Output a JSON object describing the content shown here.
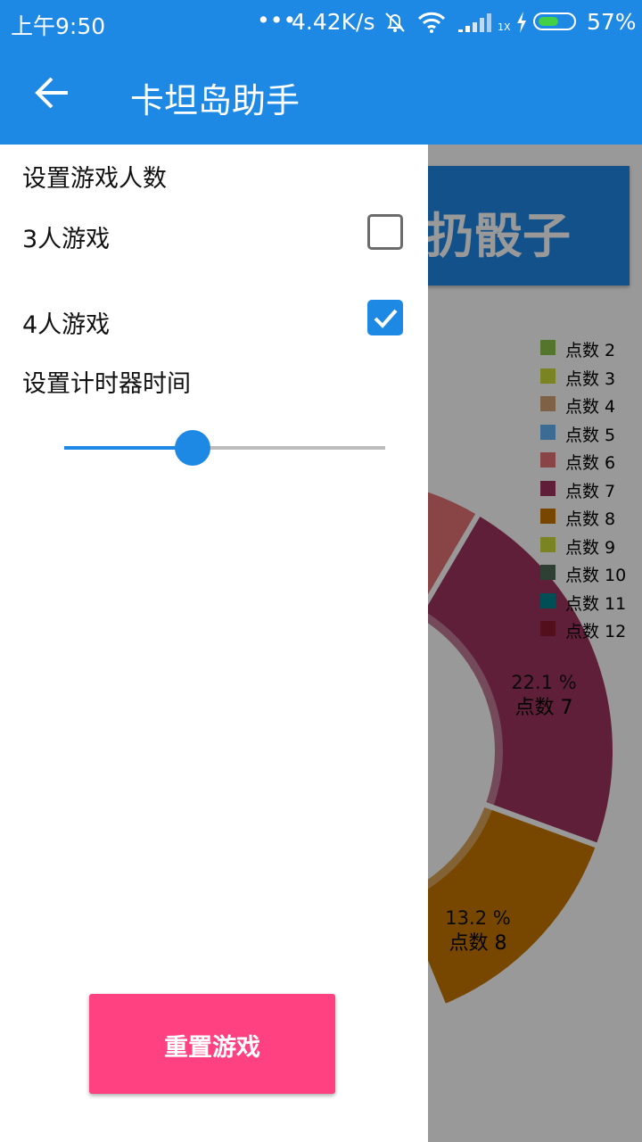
{
  "status_bar": {
    "time": "上午9:50",
    "dots": "•••",
    "speed": "4.42K/s",
    "network_type": "1X",
    "battery_percent": "57%",
    "battery_level": 0.57,
    "icons": [
      "bell-off-icon",
      "wifi-icon",
      "signal-icon",
      "charging-icon",
      "battery-icon"
    ]
  },
  "app_bar": {
    "title": "卡坦岛助手",
    "back_icon": "arrow-back-icon"
  },
  "background": {
    "roll_button_label": "扔骰子",
    "roll_button_visible_text": "扔骰子"
  },
  "chart_data": {
    "type": "pie",
    "style": "donut",
    "legend_position": "top-right",
    "series_names": [
      "点数 2",
      "点数 3",
      "点数 4",
      "点数 5",
      "点数 6",
      "点数 7",
      "点数 8",
      "点数 9",
      "点数 10",
      "点数 11",
      "点数 12"
    ],
    "colors": [
      "#8bc34a",
      "#cddc39",
      "#d4a373",
      "#64b5f6",
      "#e57373",
      "#a0345f",
      "#c77700",
      "#cddc39",
      "#4e6b55",
      "#00838f",
      "#8b1a2e"
    ],
    "visible_slices": [
      {
        "label": "点数 7",
        "percent": 22.1,
        "percent_label": "22.1 %",
        "name_label": "点数 7"
      },
      {
        "label": "点数 8",
        "percent": 13.2,
        "percent_label": "13.2 %",
        "name_label": "点数 8"
      }
    ]
  },
  "drawer": {
    "players_heading": "设置游戏人数",
    "options": [
      {
        "label": "3人游戏",
        "checked": false
      },
      {
        "label": "4人游戏",
        "checked": true
      }
    ],
    "timer_heading": "设置计时器时间",
    "timer_slider_value": 0.4,
    "reset_button_label": "重置游戏"
  },
  "colors": {
    "primary": "#1e88e5",
    "accent": "#ff4081"
  }
}
